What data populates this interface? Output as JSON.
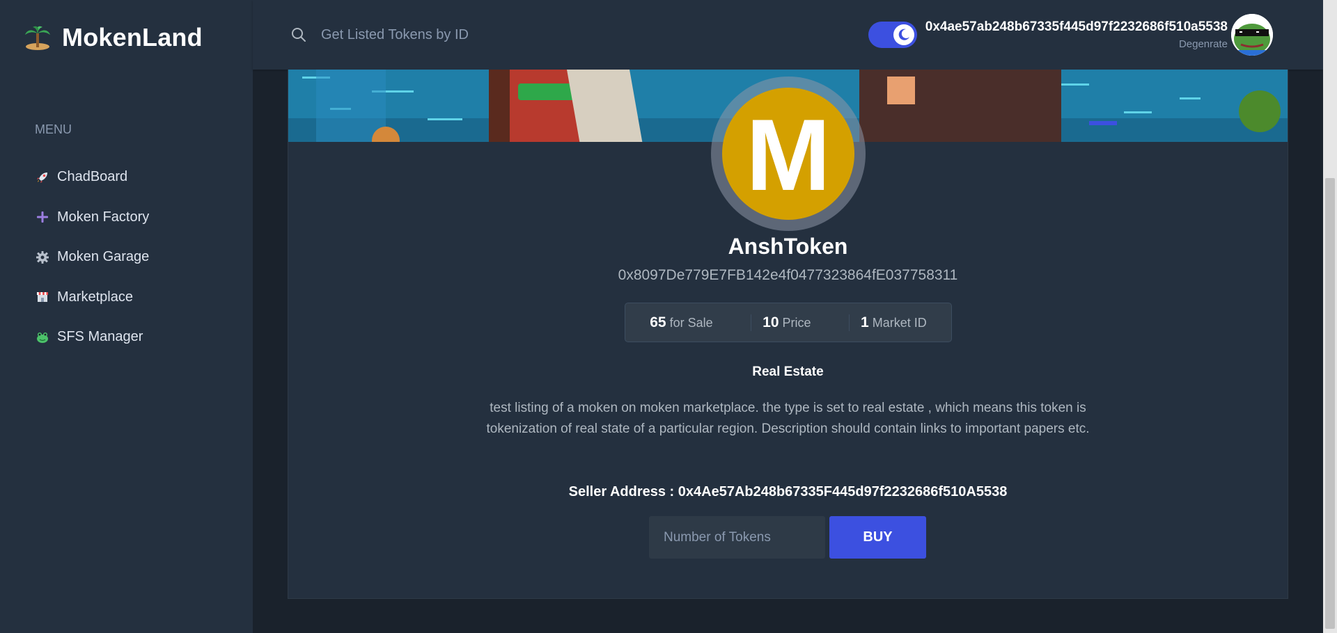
{
  "app": {
    "name": "MokenLand"
  },
  "sidebar": {
    "menu_heading": "MENU",
    "items": [
      {
        "label": "ChadBoard",
        "icon": "rocket-icon"
      },
      {
        "label": "Moken Factory",
        "icon": "plus-icon"
      },
      {
        "label": "Moken Garage",
        "icon": "gear-icon"
      },
      {
        "label": "Marketplace",
        "icon": "store-icon"
      },
      {
        "label": "SFS Manager",
        "icon": "frog-icon"
      }
    ]
  },
  "header": {
    "search_placeholder": "Get Listed Tokens by ID",
    "theme_toggle": {
      "state": "dark",
      "icon": "moon-icon"
    },
    "user": {
      "address": "0x4ae57ab248b67335f445d97f2232686f510a5538",
      "role": "Degenrate"
    }
  },
  "listing": {
    "profile_letter": "M",
    "name": "AnshToken",
    "address": "0x8097De779E7FB142e4f0477323864fE037758311",
    "stats": [
      {
        "value": "65",
        "label": "for Sale"
      },
      {
        "value": "10",
        "label": "Price"
      },
      {
        "value": "1",
        "label": "Market ID"
      }
    ],
    "category": "Real Estate",
    "description": "test listing of a moken on moken marketplace. the type is set to real estate , which means this token is tokenization of real state of a particular region. Description should contain links to important papers etc.",
    "seller": "Seller Address : 0x4Ae57Ab248b67335F445d97f2232686f510A5538",
    "quantity_placeholder": "Number of Tokens",
    "buy_label": "BUY"
  },
  "colors": {
    "accent": "#3c50e0",
    "token_badge": "#d4a000",
    "panel": "#24303f",
    "background": "#1a222c"
  }
}
